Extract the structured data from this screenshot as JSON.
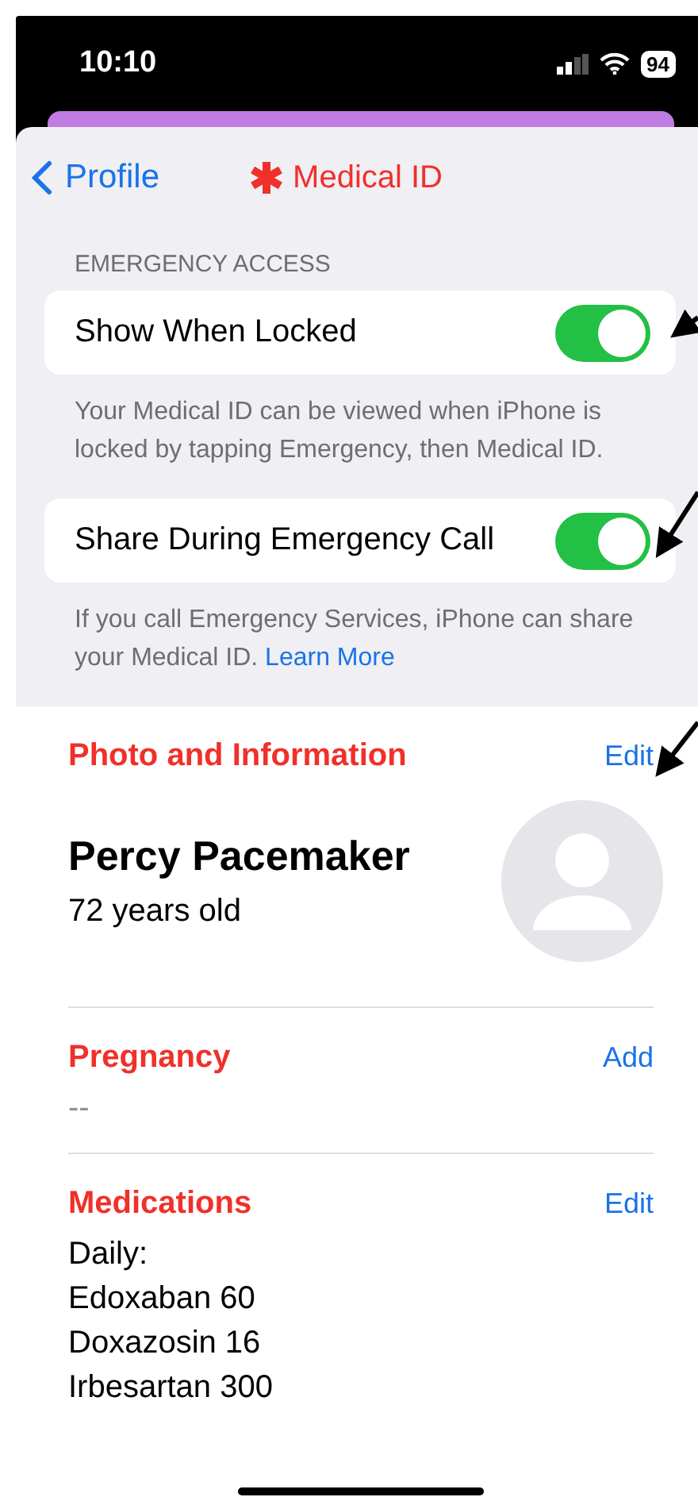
{
  "status_bar": {
    "time": "10:10",
    "battery": "94"
  },
  "nav": {
    "back": "Profile",
    "title": "Medical ID"
  },
  "emergency_access": {
    "header": "EMERGENCY ACCESS",
    "settings": [
      {
        "label": "Show When Locked",
        "on": true,
        "footnote": "Your Medical ID can be viewed when iPhone is locked by tapping Emergency, then Medical ID."
      },
      {
        "label": "Share During Emergency Call",
        "on": true,
        "footnote": "If you call Emergency Services, iPhone can share your Medical ID.",
        "link": "Learn More"
      }
    ]
  },
  "photo_section": {
    "title": "Photo and Information",
    "action": "Edit",
    "name": "Percy Pacemaker",
    "age": "72 years old"
  },
  "sections": [
    {
      "title": "Pregnancy",
      "action": "Add",
      "lines": [
        "--"
      ],
      "kind": "placeholder"
    },
    {
      "title": "Medications",
      "action": "Edit",
      "lines": [
        "Daily:",
        "Edoxaban 60",
        "Doxazosin 16",
        "Irbesartan 300"
      ],
      "kind": "list"
    }
  ]
}
